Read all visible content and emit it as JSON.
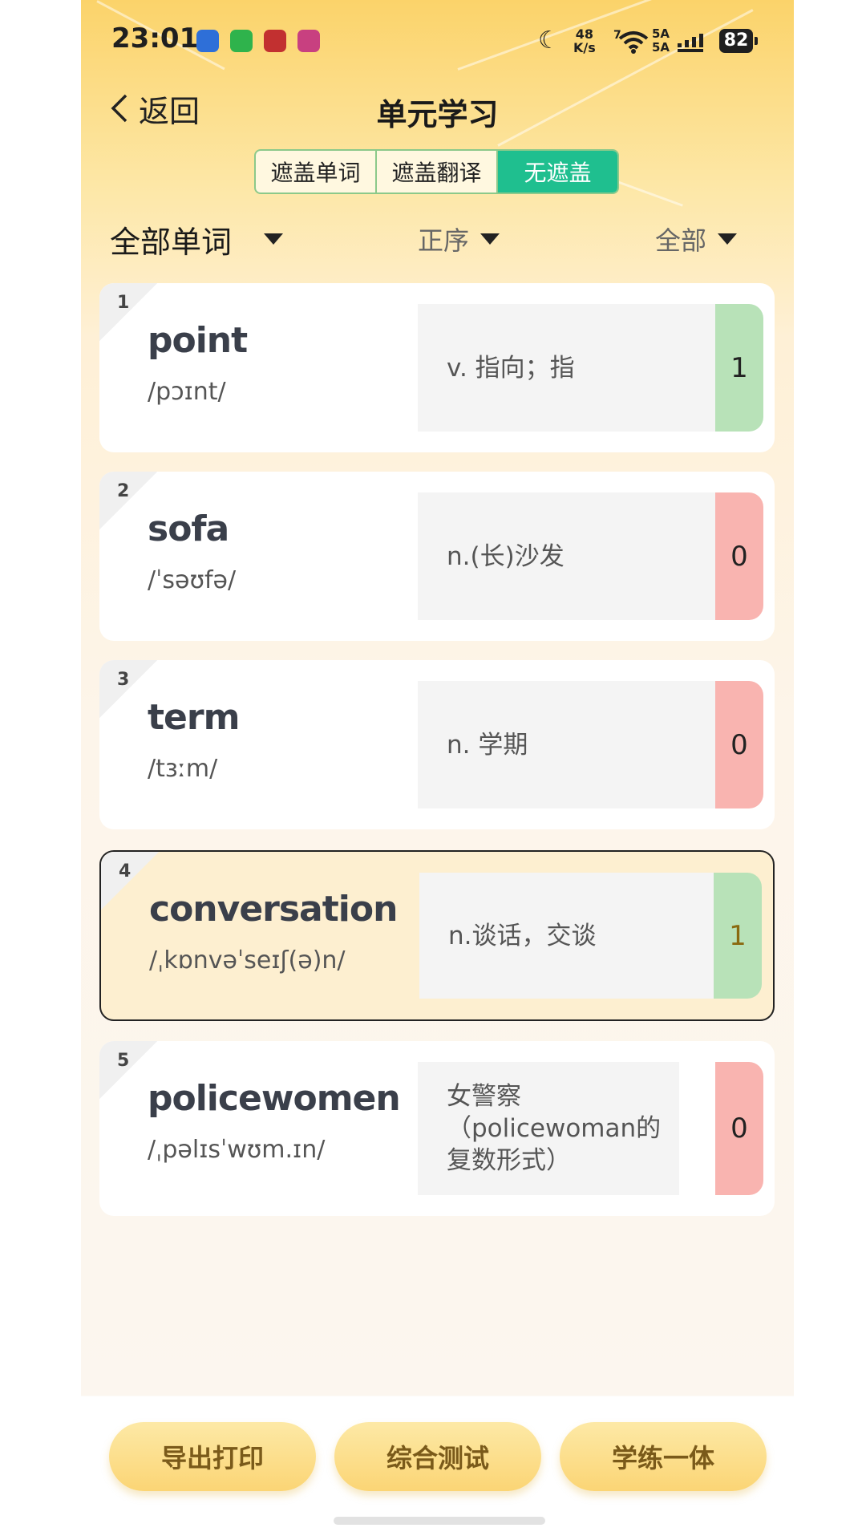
{
  "status_bar": {
    "time": "23:01",
    "net_speed_value": "48",
    "net_speed_unit": "K/s",
    "wifi_label": "7",
    "sim1": "5A",
    "sim2": "5A",
    "battery": "82"
  },
  "header": {
    "back_label": "返回",
    "title": "单元学习"
  },
  "segment": {
    "options": [
      "遮盖单词",
      "遮盖翻译",
      "无遮盖"
    ],
    "selected": "无遮盖"
  },
  "filters": {
    "scope": "全部单词",
    "order": "正序",
    "status": "全部"
  },
  "words": [
    {
      "index": "1",
      "word": "point",
      "phonetic": "/pɔɪnt/",
      "translation": "v. 指向；指",
      "count": "1",
      "count_color": "#b8e2b8"
    },
    {
      "index": "2",
      "word": "sofa",
      "phonetic": "/ˈsəʊfə/",
      "translation": "n.(长)沙发",
      "count": "0",
      "count_color": "#f9b4b0"
    },
    {
      "index": "3",
      "word": "term",
      "phonetic": "/tɜːm/",
      "translation": "n. 学期",
      "count": "0",
      "count_color": "#f9b4b0"
    },
    {
      "index": "4",
      "word": "conversation",
      "phonetic": "/ˌkɒnvəˈseɪʃ(ə)n/",
      "translation": "n.谈话，交谈",
      "count": "1",
      "count_color": "#b8e2b8",
      "highlighted": true
    },
    {
      "index": "5",
      "word": "policewomen",
      "phonetic": "/ˌpəlɪsˈwʊm.ɪn/",
      "translation": "女警察（policewoman的复数形式）",
      "count": "0",
      "count_color": "#f9b4b0"
    }
  ],
  "bottom_actions": {
    "export_print": "导出打印",
    "comprehensive_test": "综合测试",
    "learn_practice": "学练一体"
  },
  "colors": {
    "accent_green": "#1fbf8f",
    "correct_green": "#b8e2b8",
    "wrong_red": "#f9b4b0",
    "button_yellow": "#fbd575"
  }
}
